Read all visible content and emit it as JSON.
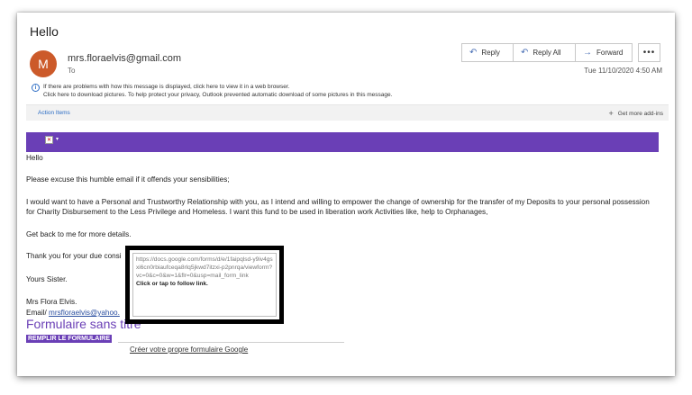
{
  "email": {
    "subject": "Hello",
    "avatar_initial": "M",
    "sender": "mrs.floraelvis@gmail.com",
    "to_label": "To",
    "timestamp": "Tue 11/10/2020 4:50 AM"
  },
  "actions": {
    "reply": "Reply",
    "reply_all": "Reply All",
    "forward": "Forward",
    "more": "•••"
  },
  "info": {
    "line1": "If there are problems with how this message is displayed, click here to view it in a web browser.",
    "line2": "Click here to download pictures. To help protect your privacy, Outlook prevented automatic download of some pictures in this message."
  },
  "addins": {
    "action_items": "Action Items",
    "get_more": "Get more add-ins"
  },
  "body": {
    "hello": "Hello",
    "excuse": "Please excuse this humble email if it offends your sensibilities;",
    "para1": "I would want to have a Personal and Trustworthy Relationship with you, as I intend and willing to empower the change of ownership for the transfer of my Deposits to your personal possession for Charity Disbursement to the Less Privilege and Homeless. I want this fund to be used in liberation work Activities like, help to Orphanages,",
    "back": "Get back to me for more details.",
    "thanks": "Thank you for your due consi",
    "yours": "Yours Sister.",
    "mrs": "Mrs Flora Elvis.",
    "email_label": "Email/",
    "email_link": "mrsfloraelvis@yahoo."
  },
  "form": {
    "title": "Formulaire sans titre",
    "fill_button": "REMPLIR LE FORMULAIRE",
    "create_link": "Créer votre propre formulaire Google"
  },
  "tooltip": {
    "url": "https://docs.google.com/forms/d/e/1faipqlsd-y9iv4gsxi6cn0rbiaufceqa8rlq5jkwd7itzxi-p2pnrqa/viewform?vc=0&c=0&w=1&flr=0&usp=mail_form_link",
    "hint": "Click or tap to follow link."
  },
  "colors": {
    "banner": "#6a3fb6",
    "avatar": "#cc5a2a",
    "link": "#2b6cc4"
  }
}
